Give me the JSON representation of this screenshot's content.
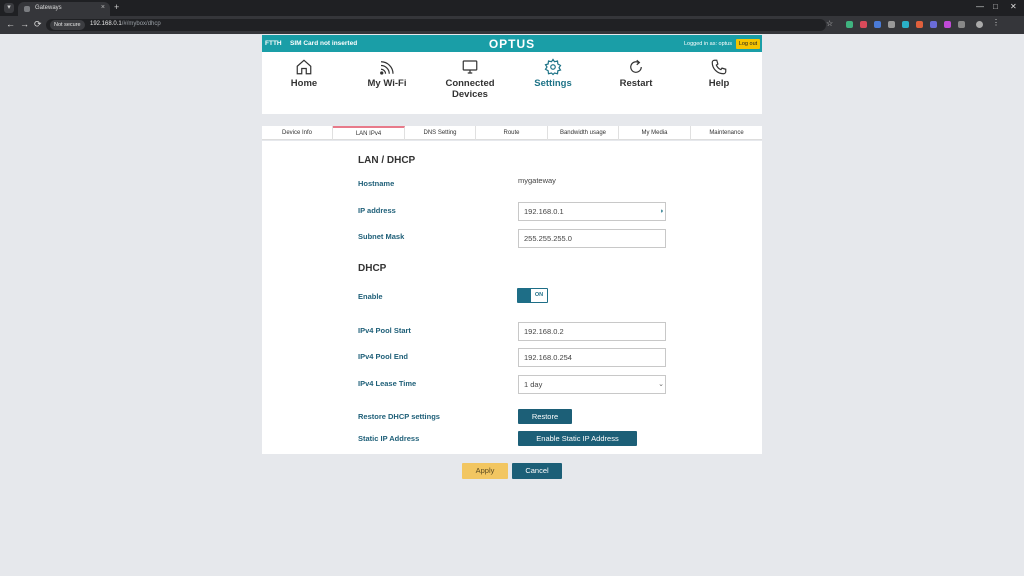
{
  "browser": {
    "tab_title": "Gateways",
    "tab_close": "×",
    "new_tab": "+",
    "security": "Not secure",
    "url_host": "192.168.0.1",
    "url_path": "/#/mybox/dhcp",
    "back": "←",
    "forward": "→",
    "reload": "⟳",
    "star": "☆",
    "minimize": "—",
    "maximize": "□",
    "close": "✕"
  },
  "header": {
    "ftth": "FTTH",
    "sim_status": "SIM Card not inserted",
    "brand": "OPTUS",
    "logged_in": "Logged in as: optus",
    "logout": "Log out"
  },
  "main_nav": [
    {
      "label": "Home",
      "icon": "home-icon"
    },
    {
      "label": "My Wi-Fi",
      "icon": "wifi-icon"
    },
    {
      "label": "Connected",
      "label2": "Devices",
      "icon": "monitor-icon"
    },
    {
      "label": "Settings",
      "icon": "gear-icon",
      "active": true
    },
    {
      "label": "Restart",
      "icon": "restart-icon"
    },
    {
      "label": "Help",
      "icon": "phone-icon"
    }
  ],
  "sub_tabs": [
    "Device Info",
    "LAN IPv4",
    "DNS Setting",
    "Route",
    "Bandwidth usage",
    "My Media",
    "Maintenance"
  ],
  "lan": {
    "heading": "LAN / DHCP",
    "hostname_label": "Hostname",
    "hostname_value": "mygateway",
    "ip_label": "IP address",
    "ip_value": "192.168.0.1",
    "subnet_label": "Subnet Mask",
    "subnet_value": "255.255.255.0"
  },
  "dhcp": {
    "heading": "DHCP",
    "enable_label": "Enable",
    "enable_state": "ON",
    "pool_start_label": "IPv4 Pool Start",
    "pool_start_value": "192.168.0.2",
    "pool_end_label": "IPv4 Pool End",
    "pool_end_value": "192.168.0.254",
    "lease_label": "IPv4 Lease Time",
    "lease_value": "1 day",
    "restore_label": "Restore DHCP settings",
    "restore_button": "Restore",
    "static_label": "Static IP Address",
    "static_button": "Enable Static IP Address"
  },
  "actions": {
    "apply": "Apply",
    "cancel": "Cancel"
  },
  "colors": {
    "teal": "#1a9ea7",
    "navy": "#1c5f77",
    "yellow": "#f2c661",
    "accent_tab": "#e87a8a"
  }
}
